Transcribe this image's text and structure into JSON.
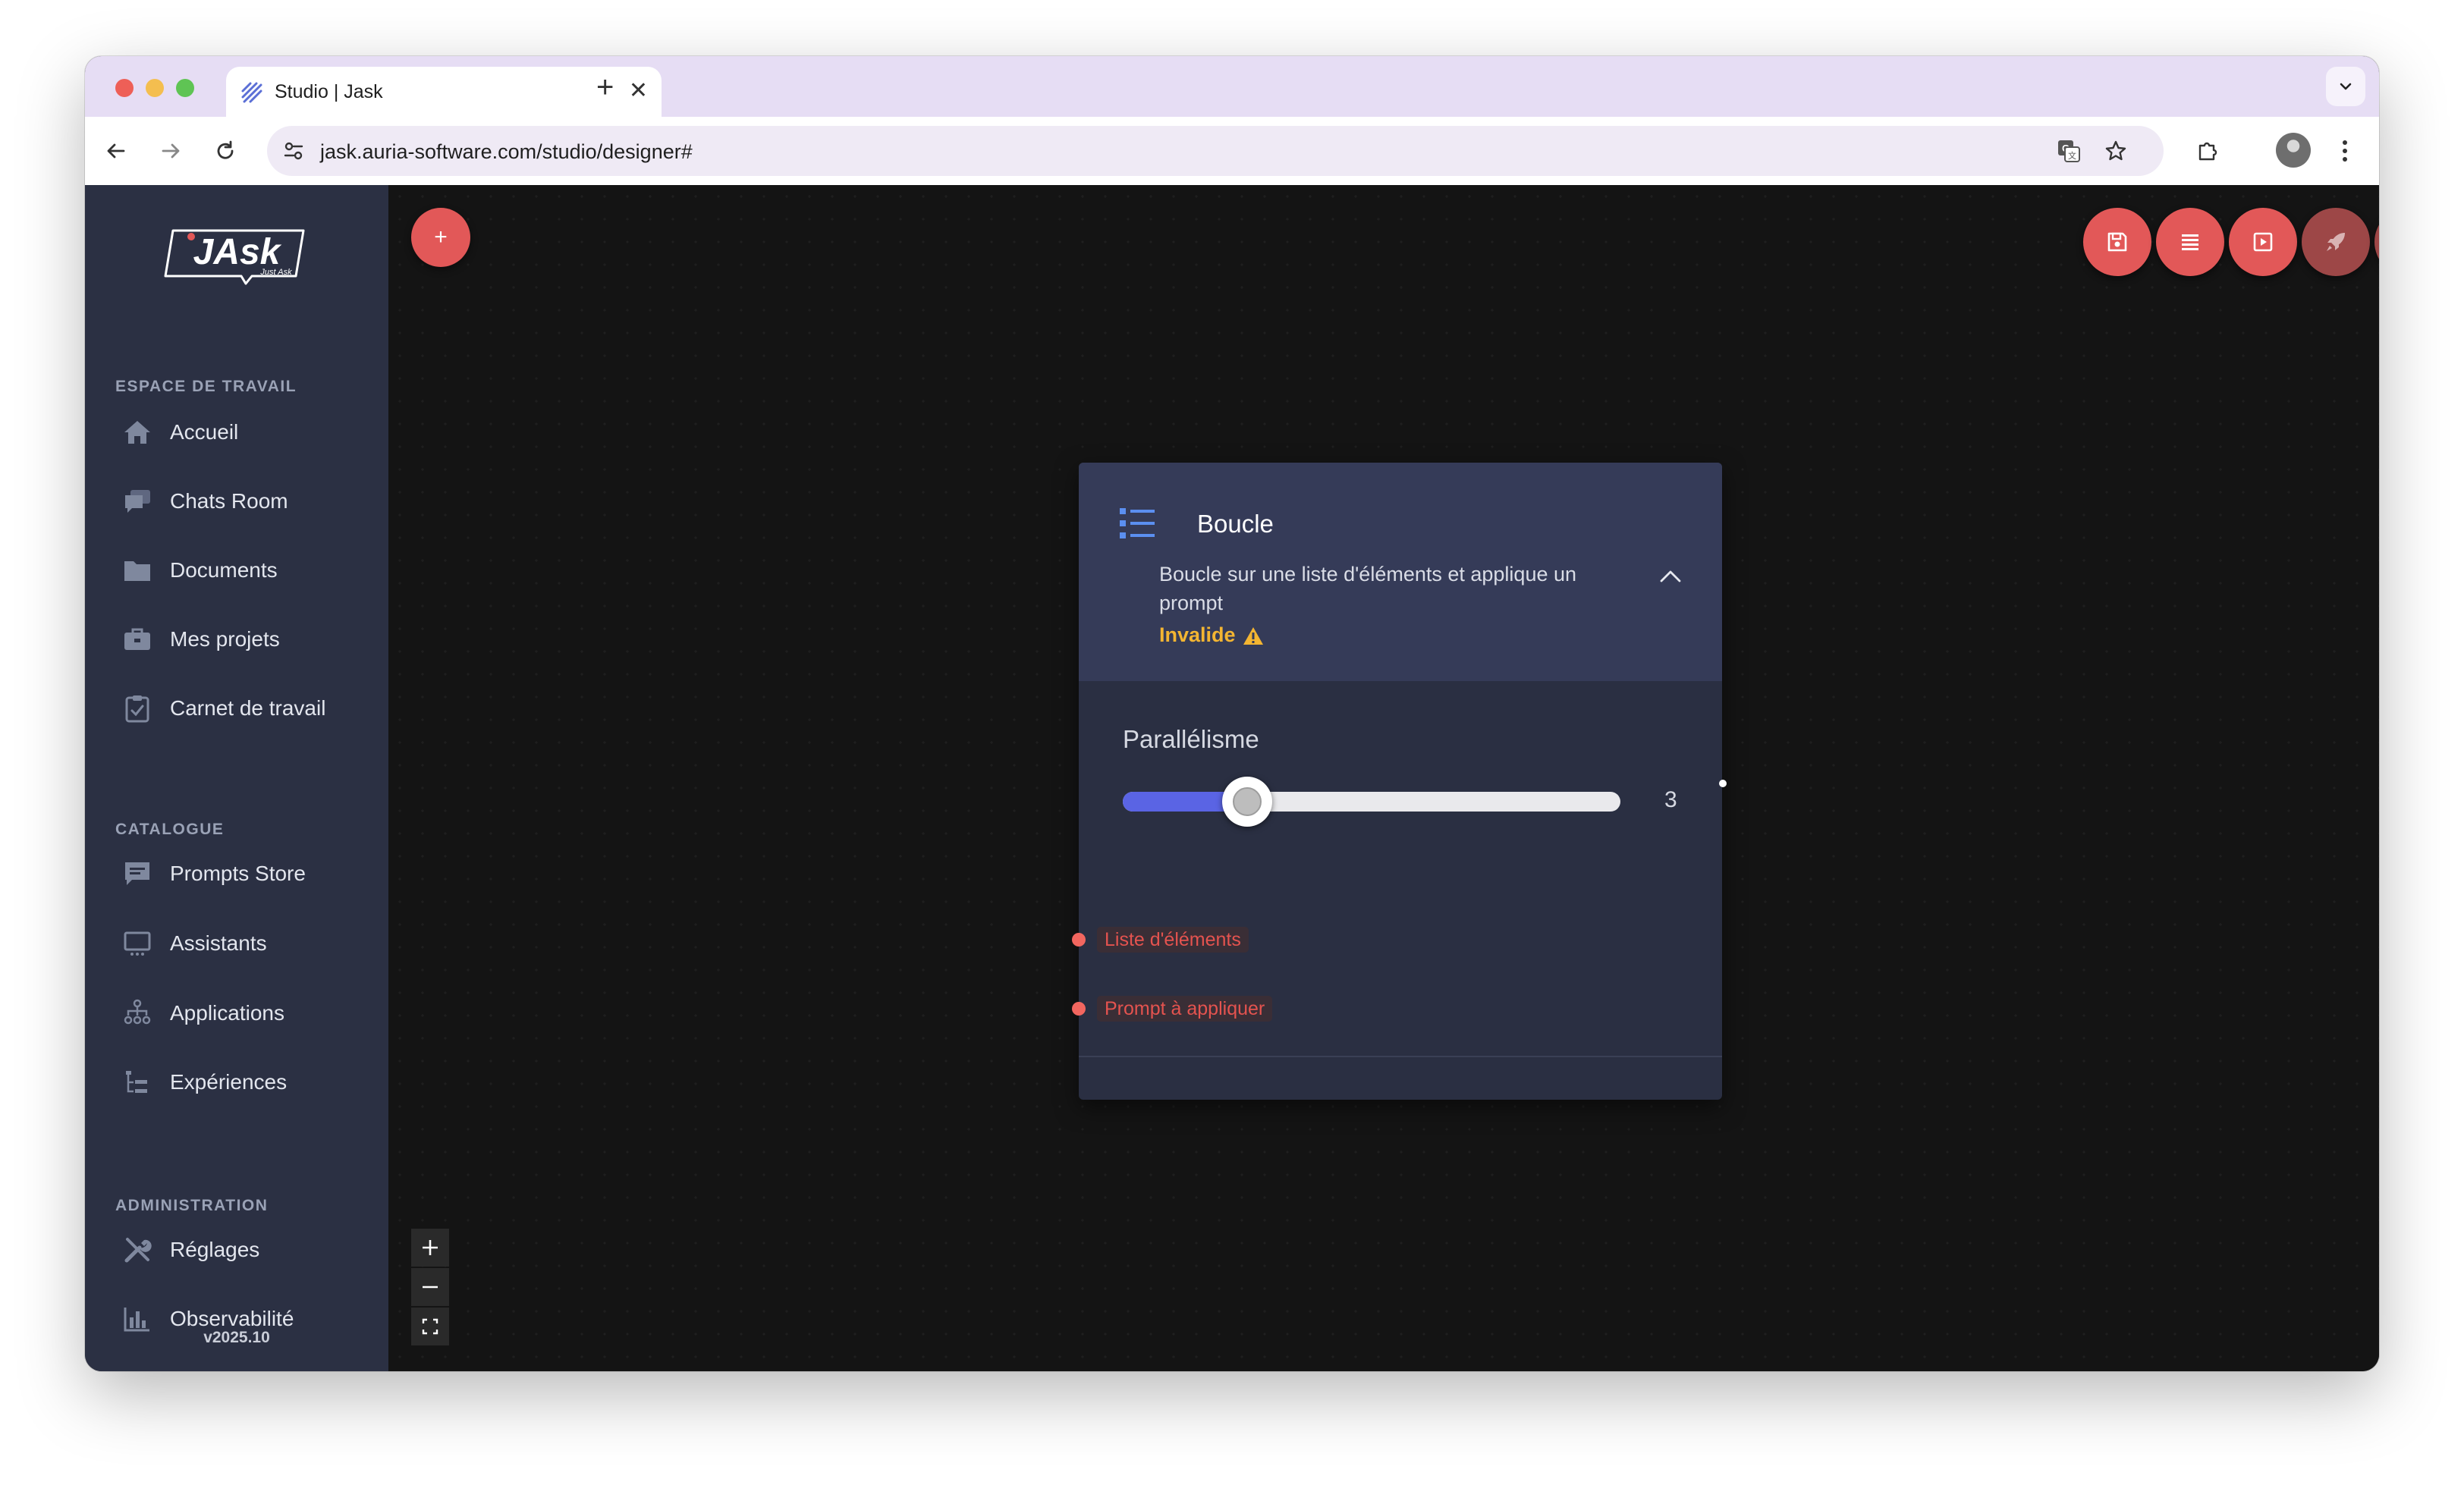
{
  "browser": {
    "tab_title": "Studio | Jask",
    "url": "jask.auria-software.com/studio/designer#"
  },
  "app": {
    "logo_text": "JAsk",
    "logo_tagline": "Just Ask",
    "version": "v2025.10"
  },
  "sidebar": {
    "sections": [
      {
        "title": "ESPACE DE TRAVAIL",
        "items": [
          {
            "label": "Accueil",
            "icon": "home-icon"
          },
          {
            "label": "Chats Room",
            "icon": "chat-icon"
          },
          {
            "label": "Documents",
            "icon": "folder-icon"
          },
          {
            "label": "Mes projets",
            "icon": "briefcase-icon"
          },
          {
            "label": "Carnet de travail",
            "icon": "clipboard-check-icon"
          }
        ]
      },
      {
        "title": "CATALOGUE",
        "items": [
          {
            "label": "Prompts Store",
            "icon": "message-icon"
          },
          {
            "label": "Assistants",
            "icon": "monitor-icon"
          },
          {
            "label": "Applications",
            "icon": "hierarchy-icon"
          },
          {
            "label": "Expériences",
            "icon": "tree-list-icon"
          }
        ]
      },
      {
        "title": "ADMINISTRATION",
        "items": [
          {
            "label": "Réglages",
            "icon": "tools-icon"
          },
          {
            "label": "Observabilité",
            "icon": "bar-chart-icon"
          }
        ]
      }
    ]
  },
  "canvas": {
    "add_button": "+",
    "actions": [
      {
        "name": "save",
        "icon": "save-icon",
        "color": "#e25858"
      },
      {
        "name": "list",
        "icon": "list-icon",
        "color": "#e25858"
      },
      {
        "name": "preview",
        "icon": "play-square-icon",
        "color": "#e25858"
      },
      {
        "name": "deploy",
        "icon": "rocket-icon",
        "color": "#9d4747"
      },
      {
        "name": "run",
        "icon": "play-icon",
        "color": "#9d4747"
      }
    ]
  },
  "node": {
    "title": "Boucle",
    "description": "Boucle sur une liste d'éléments et applique un prompt",
    "status": "Invalide",
    "param_label": "Parallélisme",
    "slider_value": "3",
    "slider_fraction": 0.25,
    "inputs": [
      "Liste d'éléments",
      "Prompt à appliquer"
    ]
  },
  "colors": {
    "accent": "#e25858",
    "slider": "#5a64e4",
    "warning": "#f3b532"
  }
}
